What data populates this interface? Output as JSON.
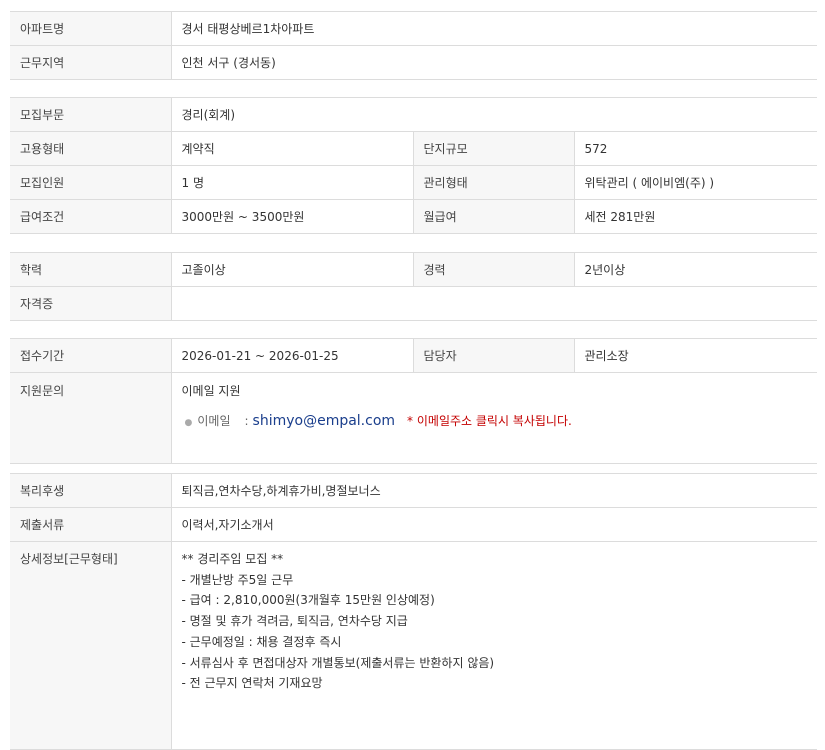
{
  "section1": [
    {
      "label": "아파트명",
      "value": "경서 태평상베르1차아파트"
    },
    {
      "label": "근무지역",
      "value": "인천  서구 (경서동)"
    }
  ],
  "section2": [
    {
      "label": "모집부문",
      "value": "경리(회계)"
    },
    {
      "label": "고용형태",
      "value": "계약직",
      "label2": "단지규모",
      "value2": "572"
    },
    {
      "label": "모집인원",
      "value": "1 명",
      "label2": "관리형태",
      "value2": "위탁관리 ( 에이비엠(주) )"
    },
    {
      "label": "급여조건",
      "value": "3000만원 ~ 3500만원",
      "label2": "월급여",
      "value2": "세전 281만원"
    }
  ],
  "section3": [
    {
      "label": "학력",
      "value": "고졸이상",
      "label2": "경력",
      "value2": "2년이상"
    },
    {
      "label": "자격증",
      "value": ""
    }
  ],
  "section4": {
    "period": {
      "label": "접수기간",
      "value": "2026-01-21 ~ 2026-01-25",
      "label2": "담당자",
      "value2": "관리소장"
    },
    "inquiry": {
      "label": "지원문의",
      "title": "이메일 지원",
      "email_key": "이메일",
      "email_sep": ":",
      "email": "shimyo@empal.com",
      "copy_note": "* 이메일주소 클릭시 복사됩니다."
    }
  },
  "section5": {
    "welfare": {
      "label": "복리후생",
      "value": "퇴직금,연차수당,하계휴가비,명절보너스"
    },
    "documents": {
      "label": "제출서류",
      "value": "이력서,자기소개서"
    },
    "details": {
      "label": "상세정보[근무형태]",
      "lines": [
        "** 경리주임 모집 **",
        "- 개별난방 주5일 근무",
        "- 급여 : 2,810,000원(3개월후 15만원 인상예정)",
        "- 명절 및 휴가 격려금, 퇴직금, 연차수당 지급",
        "- 근무예정일 : 채용 결정후 즉시",
        "- 서류심사 후 면접대상자 개별통보(제출서류는 반환하지 않음)",
        "- 전 근무지 연락처 기재요망"
      ]
    }
  }
}
